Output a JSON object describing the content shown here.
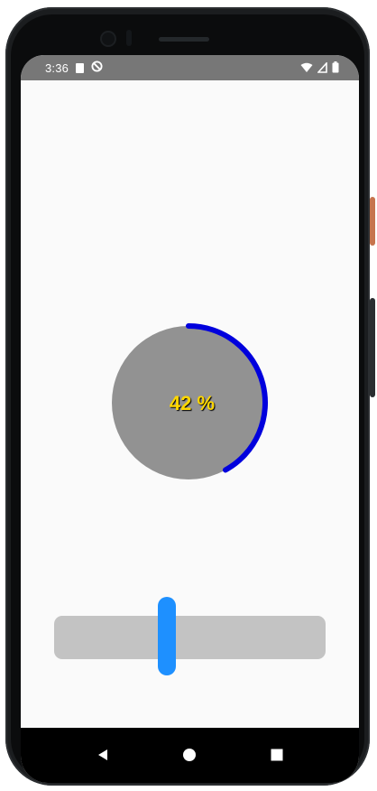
{
  "status_bar": {
    "time": "3:36",
    "icons": [
      "sd-card-icon",
      "do-not-disturb-icon",
      "wifi-icon",
      "cell-signal-icon",
      "battery-icon"
    ]
  },
  "progress": {
    "value": 42,
    "label": "42 %",
    "track_color": "#929292",
    "arc_color": "#0000dd",
    "text_color": "#ffd700"
  },
  "slider": {
    "value_fraction": 0.42,
    "track_color": "#c3c3c3",
    "thumb_color": "#1e90ff"
  },
  "nav_bar": {
    "buttons": [
      "back-icon",
      "home-icon",
      "recents-icon"
    ]
  },
  "colors": {
    "status_bar_bg": "#777777",
    "app_bg": "#fafafa",
    "nav_bar_bg": "#000000"
  }
}
